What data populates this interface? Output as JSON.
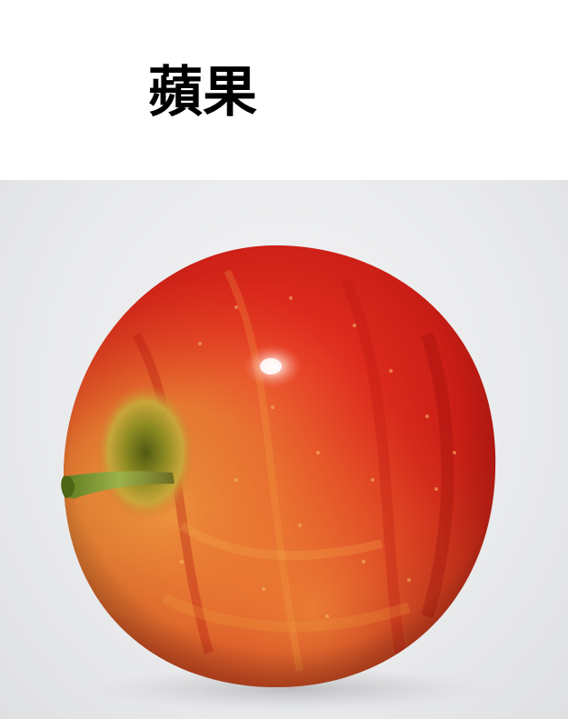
{
  "title": "蘋果",
  "image": {
    "subject": "apple-photo",
    "colors": {
      "background": "#e9eaec",
      "apple_red": "#d8241c",
      "apple_dark_red": "#a81510",
      "apple_yellow": "#e6b13a",
      "stem_green": "#7f9a34"
    }
  }
}
